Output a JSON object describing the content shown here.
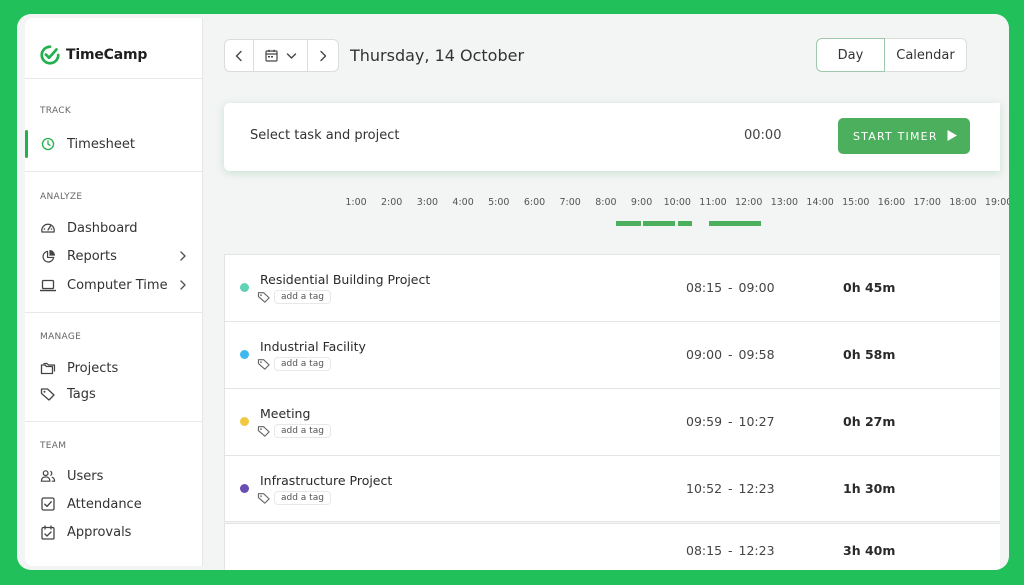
{
  "app": {
    "name": "TimeCamp",
    "brand_color": "#25b04f",
    "page_bg": "#22c05a"
  },
  "sidebar": {
    "sections": [
      {
        "label": "TRACK",
        "items": [
          {
            "label": "Timesheet",
            "icon": "clock-icon",
            "active": true
          }
        ]
      },
      {
        "label": "ANALYZE",
        "items": [
          {
            "label": "Dashboard",
            "icon": "gauge-icon"
          },
          {
            "label": "Reports",
            "icon": "pie-chart-icon",
            "chevron": true
          },
          {
            "label": "Computer Time",
            "icon": "laptop-icon",
            "chevron": true
          }
        ]
      },
      {
        "label": "MANAGE",
        "items": [
          {
            "label": "Projects",
            "icon": "folder-icon"
          },
          {
            "label": "Tags",
            "icon": "tag-icon"
          }
        ]
      },
      {
        "label": "TEAM",
        "items": [
          {
            "label": "Users",
            "icon": "users-icon"
          },
          {
            "label": "Attendance",
            "icon": "checkbox-icon"
          },
          {
            "label": "Approvals",
            "icon": "calendar-check-icon"
          }
        ]
      }
    ]
  },
  "header": {
    "date": "Thursday, 14 October",
    "views": {
      "day": "Day",
      "calendar": "Calendar",
      "selected": "Day"
    }
  },
  "timer": {
    "task_placeholder": "Select task and project",
    "time": "00:00",
    "start_label": "START TIMER",
    "button_color": "#4caf5e"
  },
  "timeline": {
    "hours": [
      "1:00",
      "2:00",
      "3:00",
      "4:00",
      "5:00",
      "6:00",
      "7:00",
      "8:00",
      "9:00",
      "10:00",
      "11:00",
      "12:00",
      "13:00",
      "14:00",
      "15:00",
      "16:00",
      "17:00",
      "18:00",
      "19:00"
    ],
    "tracked_ranges": [
      {
        "start": "08:15",
        "end": "09:00"
      },
      {
        "start": "09:00",
        "end": "09:58"
      },
      {
        "start": "09:59",
        "end": "10:27"
      },
      {
        "start": "10:52",
        "end": "12:23"
      }
    ]
  },
  "entries": [
    {
      "name": "Residential Building Project",
      "tag_label": "add a tag",
      "start": "08:15",
      "end": "09:00",
      "separator": "-",
      "duration": "0h 45m",
      "color": "#5fd3b3"
    },
    {
      "name": "Industrial Facility",
      "tag_label": "add a tag",
      "start": "09:00",
      "end": "09:58",
      "separator": "-",
      "duration": "0h 58m",
      "color": "#3fb8f0"
    },
    {
      "name": "Meeting",
      "tag_label": "add a tag",
      "start": "09:59",
      "end": "10:27",
      "separator": "-",
      "duration": "0h 27m",
      "color": "#f0c93f"
    },
    {
      "name": "Infrastructure Project",
      "tag_label": "add a tag",
      "start": "10:52",
      "end": "12:23",
      "separator": "-",
      "duration": "1h 30m",
      "color": "#6a4db5"
    }
  ],
  "total": {
    "start": "08:15",
    "end": "12:23",
    "separator": "-",
    "duration": "3h 40m"
  }
}
